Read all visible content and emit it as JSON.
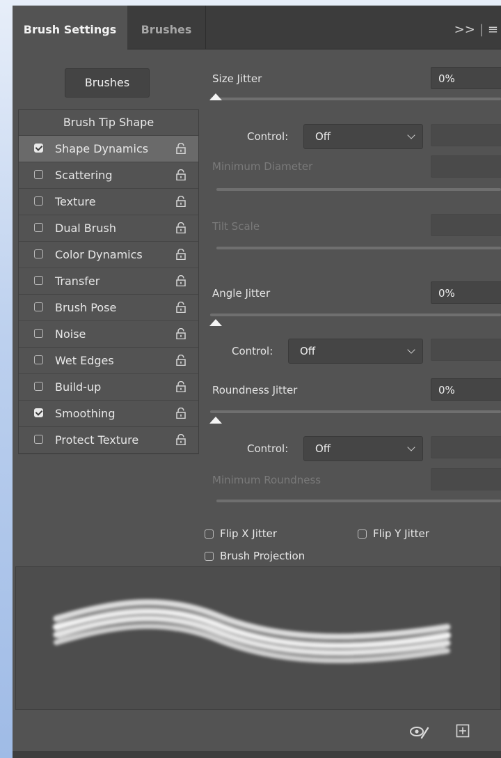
{
  "tabs": {
    "active": "Brush Settings",
    "inactive": "Brushes"
  },
  "panel_menu": {
    "collapse": ">>",
    "sep": "|",
    "menu": "≡"
  },
  "brushes_button": "Brushes",
  "sidebar": {
    "header": "Brush Tip Shape",
    "items": [
      {
        "label": "Shape Dynamics",
        "checked": true,
        "selected": true
      },
      {
        "label": "Scattering",
        "checked": false
      },
      {
        "label": "Texture",
        "checked": false
      },
      {
        "label": "Dual Brush",
        "checked": false
      },
      {
        "label": "Color Dynamics",
        "checked": false
      },
      {
        "label": "Transfer",
        "checked": false
      },
      {
        "label": "Brush Pose",
        "checked": false
      },
      {
        "label": "Noise",
        "checked": false
      },
      {
        "label": "Wet Edges",
        "checked": false
      },
      {
        "label": "Build-up",
        "checked": false
      },
      {
        "label": "Smoothing",
        "checked": true
      },
      {
        "label": "Protect Texture",
        "checked": false
      }
    ]
  },
  "size_jitter": {
    "label": "Size Jitter",
    "value": "0%",
    "slider": 0
  },
  "control1": {
    "label": "Control:",
    "value": "Off"
  },
  "min_diameter": {
    "label": "Minimum Diameter"
  },
  "tilt_scale": {
    "label": "Tilt Scale"
  },
  "angle_jitter": {
    "label": "Angle Jitter",
    "value": "0%",
    "slider": 0
  },
  "control2": {
    "label": "Control:",
    "value": "Off"
  },
  "roundness_jitter": {
    "label": "Roundness Jitter",
    "value": "0%",
    "slider": 0
  },
  "control3": {
    "label": "Control:",
    "value": "Off"
  },
  "min_roundness": {
    "label": "Minimum Roundness"
  },
  "options": {
    "flip_x": "Flip X Jitter",
    "flip_y": "Flip Y Jitter",
    "projection": "Brush Projection"
  },
  "colors": {
    "panel": "#535353",
    "tabbar": "#3c3c3c",
    "selected_row": "#6a6a6a"
  },
  "icons": [
    "lock-icon",
    "checkbox-icon",
    "eye-brush-icon",
    "new-preset-icon"
  ]
}
